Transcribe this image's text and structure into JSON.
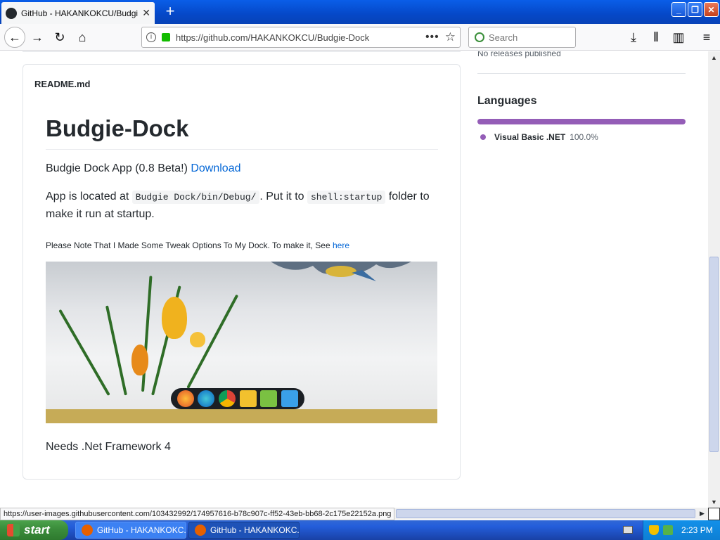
{
  "browser": {
    "tab_title": "GitHub - HAKANKOKCU/Budgie-Dock",
    "tab_close": "✕",
    "new_tab": "+",
    "url": "https://github.com/HAKANKOKCU/Budgie-Dock",
    "search_placeholder": "Search",
    "status_url": "https://user-images.githubusercontent.com/103432992/174957616-b78c907c-ff52-43eb-bb68-2c175e22152a.png",
    "window_buttons": {
      "minimize": "_",
      "maximize": "❐",
      "close": "✕"
    }
  },
  "readme": {
    "filename": "README.md",
    "heading": "Budgie-Dock",
    "intro_text": "Budgie Dock App (0.8 Beta!) ",
    "intro_link": "Download",
    "location_prefix": "App is located at ",
    "location_path": "Budgie Dock/bin/Debug/",
    "location_mid": ". Put it to ",
    "location_code": "shell:startup",
    "location_suffix": " folder to make it run at startup.",
    "note_text": "Please Note That I Made Some Tweak Options To My Dock. To make it, See ",
    "note_link": "here",
    "requirement": "Needs .Net Framework 4"
  },
  "sidebar": {
    "releases_text": "No releases published",
    "languages_title": "Languages",
    "language_name": "Visual Basic .NET",
    "language_percent": "100.0%",
    "language_color": "#945db7"
  },
  "taskbar": {
    "start_label": "start",
    "task1": "GitHub - HAKANKOKC...",
    "task2": "GitHub - HAKANKOKC...",
    "time": "2:23 PM"
  }
}
